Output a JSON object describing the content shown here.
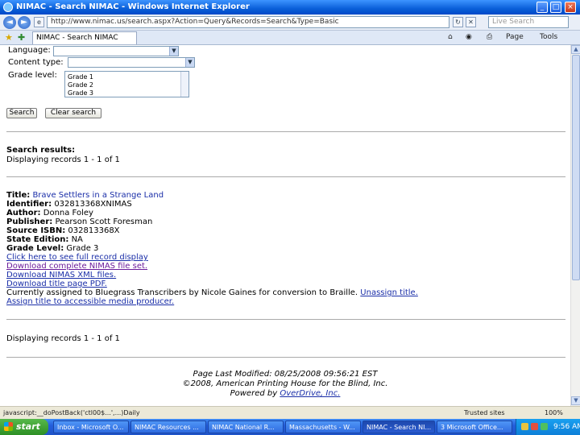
{
  "window": {
    "title": "NIMAC - Search NIMAC - Windows Internet Explorer",
    "minimize_glyph": "_",
    "maximize_glyph": "□",
    "close_glyph": "×"
  },
  "addressbar": {
    "back_glyph": "◄",
    "forward_glyph": "►",
    "url": "http://www.nimac.us/search.aspx?Action=Query&Records=Search&Type=Basic",
    "search_placeholder": "Live Search"
  },
  "tabbar": {
    "tab_label": "NIMAC - Search NIMAC",
    "commands": {
      "page": "Page",
      "tools": "Tools"
    }
  },
  "form": {
    "language_label": "Language:",
    "content_type_label": "Content type:",
    "grade_level_label": "Grade level:",
    "grade_options": [
      "Grade 1",
      "Grade 2",
      "Grade 3"
    ],
    "search_button": "Search",
    "clear_button": "Clear search"
  },
  "results": {
    "heading": "Search results:",
    "displaying_top": "Displaying records 1 - 1 of 1",
    "record": {
      "title_label": "Title:",
      "title_value": "Brave Settlers in a Strange Land",
      "identifier_label": "Identifier:",
      "identifier_value": "032813368XNIMAS",
      "author_label": "Author:",
      "author_value": "Donna Foley",
      "publisher_label": "Publisher:",
      "publisher_value": "Pearson Scott Foresman",
      "source_isbn_label": "Source ISBN:",
      "source_isbn_value": "032813368X",
      "state_edition_label": "State Edition:",
      "state_edition_value": "NA",
      "grade_level_label": "Grade Level:",
      "grade_level_value": "Grade 3"
    },
    "links": {
      "full_record": "Click here to see full record display",
      "download_nimas": "Download complete NIMAS file set.",
      "download_xml": "Download NIMAS XML files.",
      "download_pdf": "Download title page PDF.",
      "assigned_text": "Currently assigned to Bluegrass Transcribers by Nicole Gaines for conversion to Braille.",
      "unassign": "Unassign title.",
      "assign": "Assign title to accessible media producer."
    },
    "displaying_bottom": "Displaying records 1 - 1 of 1"
  },
  "footer": {
    "modified": "Page Last Modified: 08/25/2008 09:56:21 EST",
    "copyright": "©2008, American Printing House for the Blind, Inc.",
    "powered_prefix": "Powered by",
    "powered_link": "OverDrive, Inc."
  },
  "statusbar": {
    "text": "javascript:__doPostBack('ctl00$...',...)Daily",
    "zone": "Trusted sites",
    "zoom": "100%"
  },
  "taskbar": {
    "start_label": "start",
    "tasks": [
      "Inbox - Microsoft O...",
      "NIMAC Resources ...",
      "NIMAC National R...",
      "Massachusetts - W...",
      "NIMAC - Search NI...",
      "3 Microsoft Office..."
    ],
    "clock": "9:56 AM"
  }
}
